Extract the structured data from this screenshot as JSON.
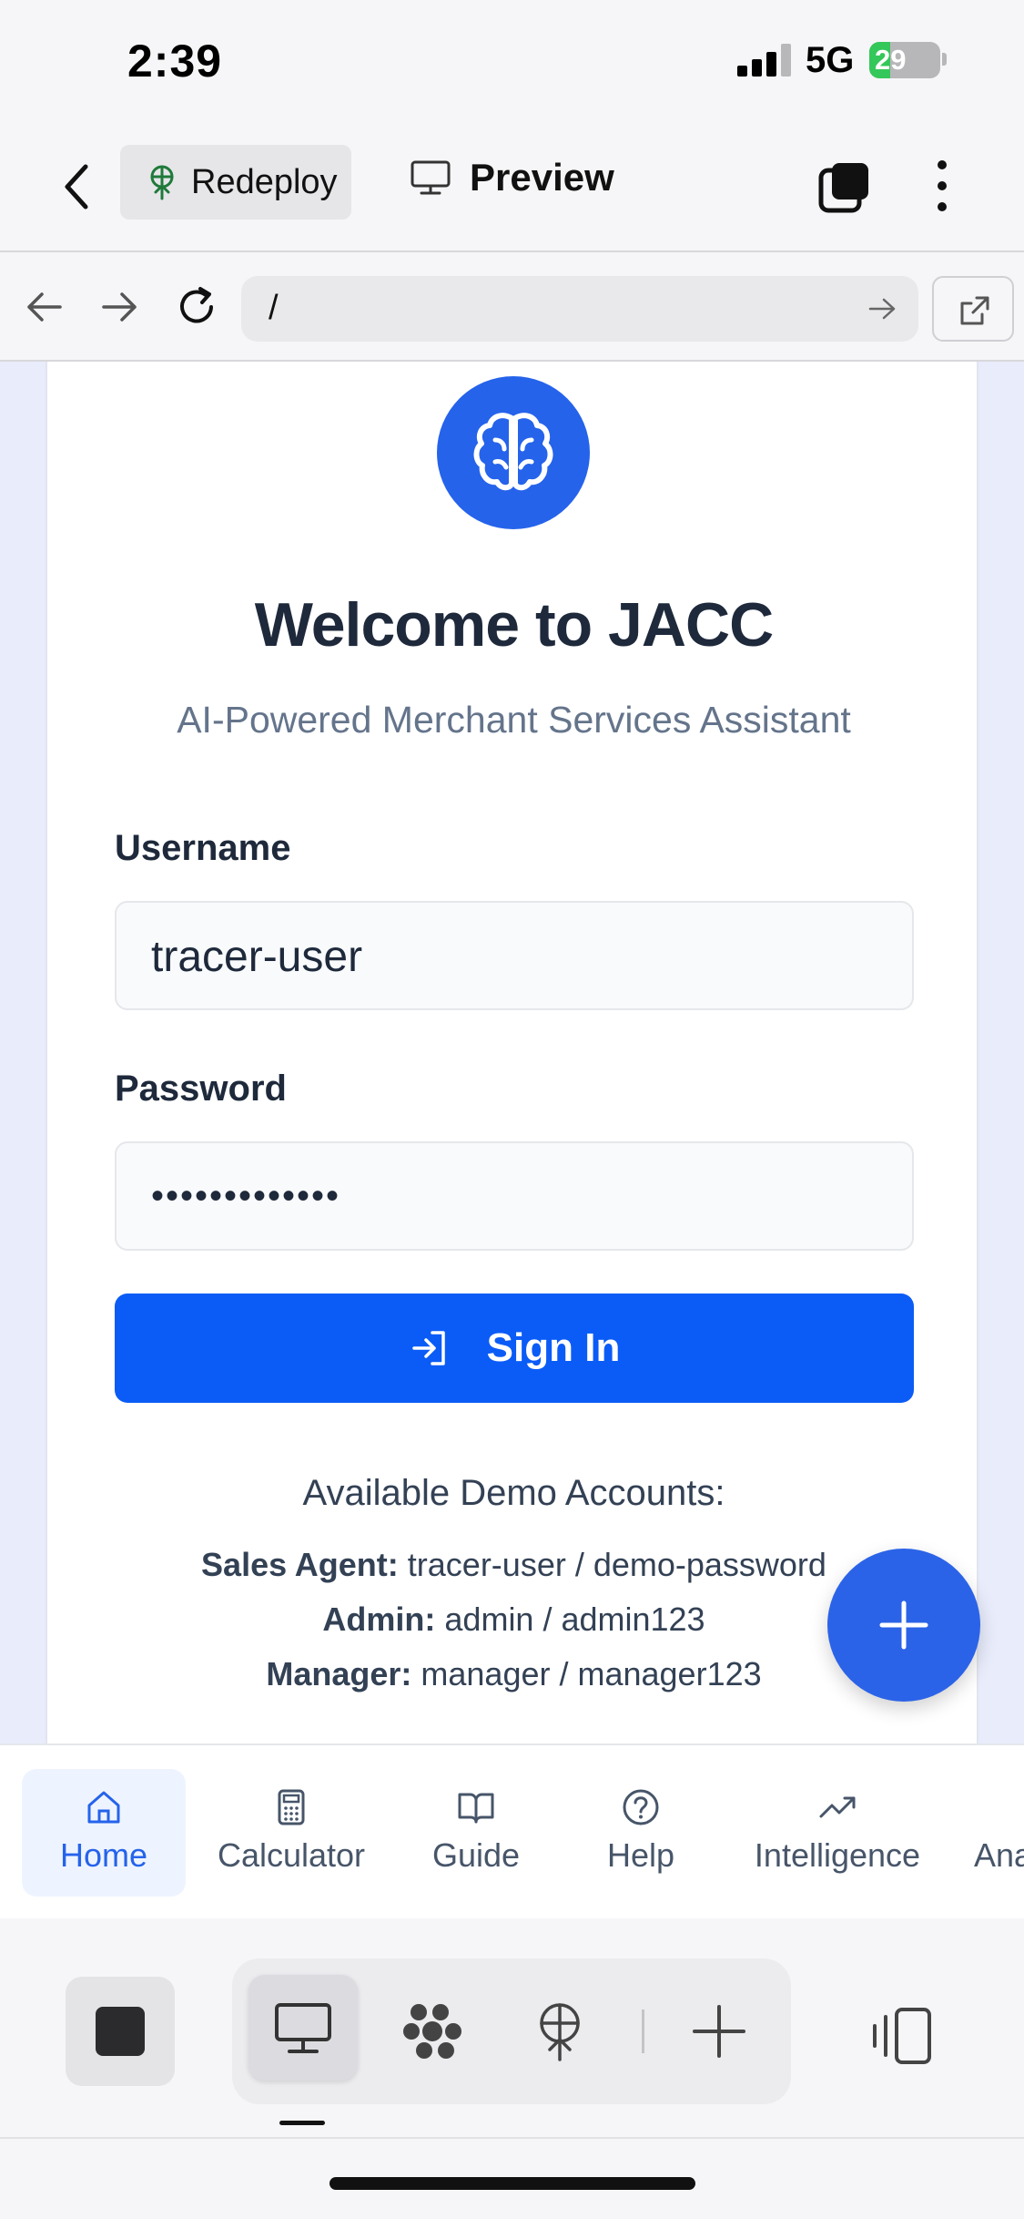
{
  "status_bar": {
    "time": "2:39",
    "network": "5G",
    "battery": "29",
    "battery_level": 0.29
  },
  "header": {
    "redeploy_label": "Redeploy",
    "preview_label": "Preview"
  },
  "url_bar": {
    "url": "/"
  },
  "login": {
    "title": "Welcome to JACC",
    "subtitle": "AI-Powered Merchant Services Assistant",
    "username_label": "Username",
    "username_value": "tracer-user",
    "password_label": "Password",
    "password_mask": "•••••••••••••",
    "signin_label": "Sign In"
  },
  "demo": {
    "title": "Available Demo Accounts:",
    "accounts": [
      {
        "role": "Sales Agent:",
        "creds": "tracer-user / demo-password"
      },
      {
        "role": "Admin:",
        "creds": "admin / admin123"
      },
      {
        "role": "Manager:",
        "creds": "manager / manager123"
      }
    ]
  },
  "bottom_nav": {
    "items": [
      {
        "label": "Home",
        "icon": "home-icon"
      },
      {
        "label": "Calculator",
        "icon": "calculator-icon"
      },
      {
        "label": "Guide",
        "icon": "book-icon"
      },
      {
        "label": "Help",
        "icon": "help-circle-icon"
      },
      {
        "label": "Intelligence",
        "icon": "trending-up-icon"
      },
      {
        "label": "Ana",
        "icon": "analytics-icon"
      }
    ]
  },
  "colors": {
    "primary": "#2563eb",
    "signin_button": "#0b5cf6",
    "page_bg": "#e8ecfb"
  }
}
